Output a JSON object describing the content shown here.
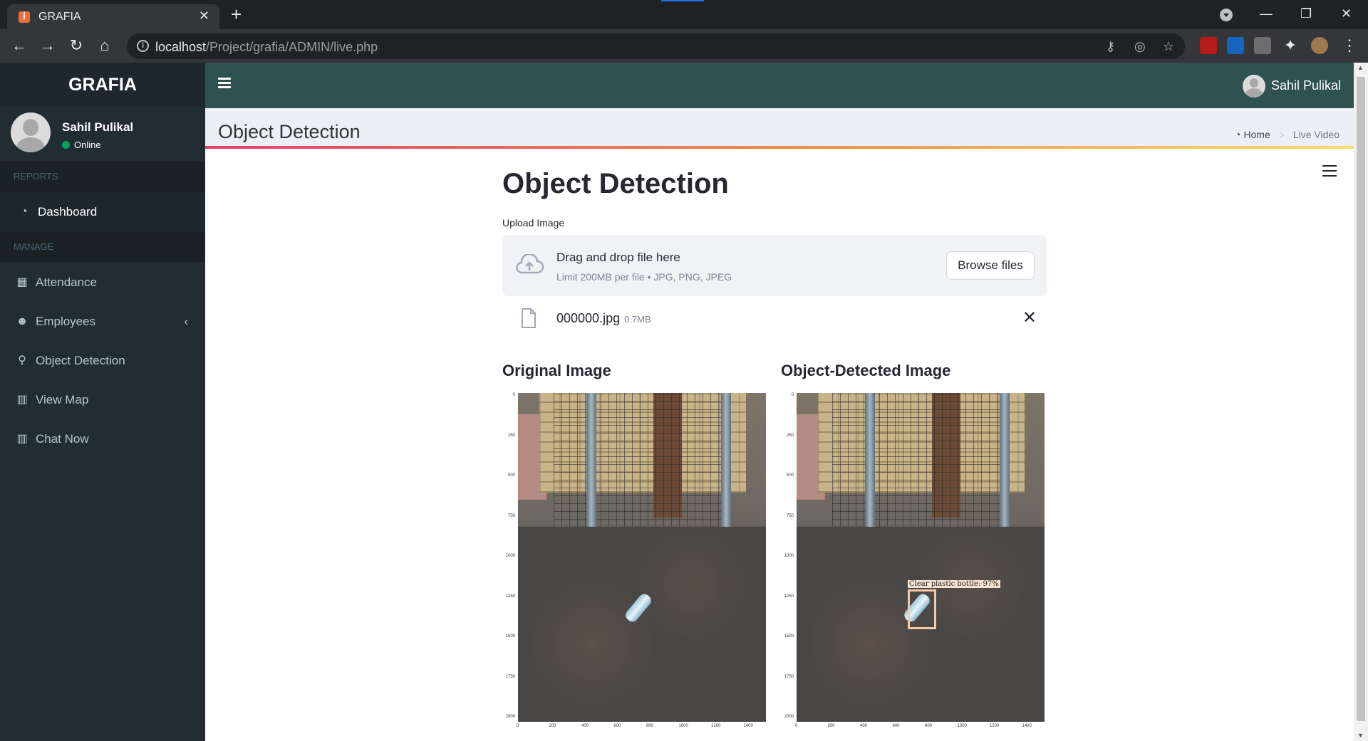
{
  "browser": {
    "tab_title": "GRAFIA",
    "url_host": "localhost",
    "url_path": "/Project/grafia/ADMIN/live.php",
    "icons": [
      "back-icon",
      "forward-icon",
      "reload-icon",
      "home-icon",
      "info-icon",
      "key-icon",
      "eye-off-icon",
      "star-icon",
      "puzzle-icon"
    ]
  },
  "sidebar": {
    "brand": "GRAFIA",
    "user_name": "Sahil Pulikal",
    "user_status": "Online",
    "sections": [
      {
        "heading": "REPORTS"
      },
      {
        "heading": "MANAGE"
      }
    ],
    "items": [
      {
        "label": "Dashboard",
        "icon": "dashboard-icon"
      },
      {
        "label": "Attendance",
        "icon": "calendar-icon"
      },
      {
        "label": "Employees",
        "icon": "users-icon"
      },
      {
        "label": "Object Detection",
        "icon": "map-marker-icon"
      },
      {
        "label": "View Map",
        "icon": "bar-chart-icon"
      },
      {
        "label": "Chat Now",
        "icon": "bar-chart-icon"
      }
    ]
  },
  "header": {
    "user_name": "Sahil Pulikal"
  },
  "content_header": {
    "title": "Object Detection",
    "breadcrumb": [
      "Home",
      "Live Video"
    ]
  },
  "streamlit": {
    "title": "Object Detection",
    "upload_label": "Upload Image",
    "dropzone_main": "Drag and drop file here",
    "dropzone_sub": "Limit 200MB per file • JPG, PNG, JPEG",
    "browse_label": "Browse files",
    "file_name": "000000.jpg",
    "file_size": "0.7MB",
    "original_title": "Original Image",
    "detected_title": "Object-Detected Image",
    "detection_label": "Clear plastic bottle: 97%",
    "y_ticks": [
      "0",
      "250",
      "500",
      "750",
      "1000",
      "1250",
      "1500",
      "1750",
      "2000"
    ],
    "x_ticks": [
      "0",
      "200",
      "400",
      "600",
      "800",
      "1000",
      "1200",
      "1400"
    ]
  },
  "colors": {
    "sidebar_bg": "#222d32",
    "header_bg": "#2f5151",
    "status_online": "#00a65a"
  }
}
